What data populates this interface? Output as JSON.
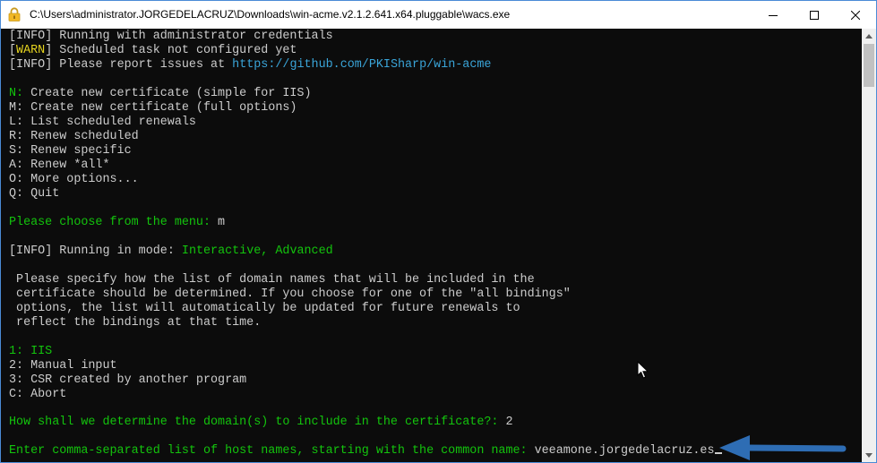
{
  "window": {
    "title": "C:\\Users\\administrator.JORGEDELACRUZ\\Downloads\\win-acme.v2.1.2.641.x64.pluggable\\wacs.exe",
    "icon": "lock-icon",
    "controls": {
      "minimize": "minimize-icon",
      "maximize": "maximize-icon",
      "close": "close-icon"
    }
  },
  "colors": {
    "console_bg": "#0c0c0c",
    "text": "#cccccc",
    "green": "#13c40d",
    "yellow": "#e5d31f",
    "link": "#3aa5d9",
    "annotation_arrow": "#2e6db4"
  },
  "console": {
    "info_tag": "INFO",
    "warn_tag": "WARN",
    "log_running_admin": " Running with administrator credentials",
    "log_no_task": " Scheduled task not configured yet",
    "log_report": " Please report issues at ",
    "report_url": "https://github.com/PKISharp/win-acme",
    "main_menu": [
      {
        "key": "N:",
        "label": " Create new certificate (simple for IIS)",
        "highlight": true
      },
      {
        "key": "M:",
        "label": " Create new certificate (full options)"
      },
      {
        "key": "L:",
        "label": " List scheduled renewals"
      },
      {
        "key": "R:",
        "label": " Renew scheduled"
      },
      {
        "key": "S:",
        "label": " Renew specific"
      },
      {
        "key": "A:",
        "label": " Renew *all*"
      },
      {
        "key": "O:",
        "label": " More options..."
      },
      {
        "key": "Q:",
        "label": " Quit"
      }
    ],
    "menu_prompt": "Please choose from the menu: ",
    "menu_answer": "m",
    "mode_text": " Running in mode: ",
    "mode_value": "Interactive, Advanced",
    "description": [
      " Please specify how the list of domain names that will be included in the",
      " certificate should be determined. If you choose for one of the \"all bindings\"",
      " options, the list will automatically be updated for future renewals to",
      " reflect the bindings at that time."
    ],
    "source_menu": [
      {
        "key": "1:",
        "label": " IIS",
        "highlight": true
      },
      {
        "key": "2:",
        "label": " Manual input"
      },
      {
        "key": "3:",
        "label": " CSR created by another program"
      },
      {
        "key": "C:",
        "label": " Abort"
      }
    ],
    "domain_prompt": "How shall we determine the domain(s) to include in the certificate?: ",
    "domain_answer": "2",
    "host_prompt": "Enter comma-separated list of host names, starting with the common name: ",
    "host_answer": "veeamone.jorgedelacruz.es"
  }
}
